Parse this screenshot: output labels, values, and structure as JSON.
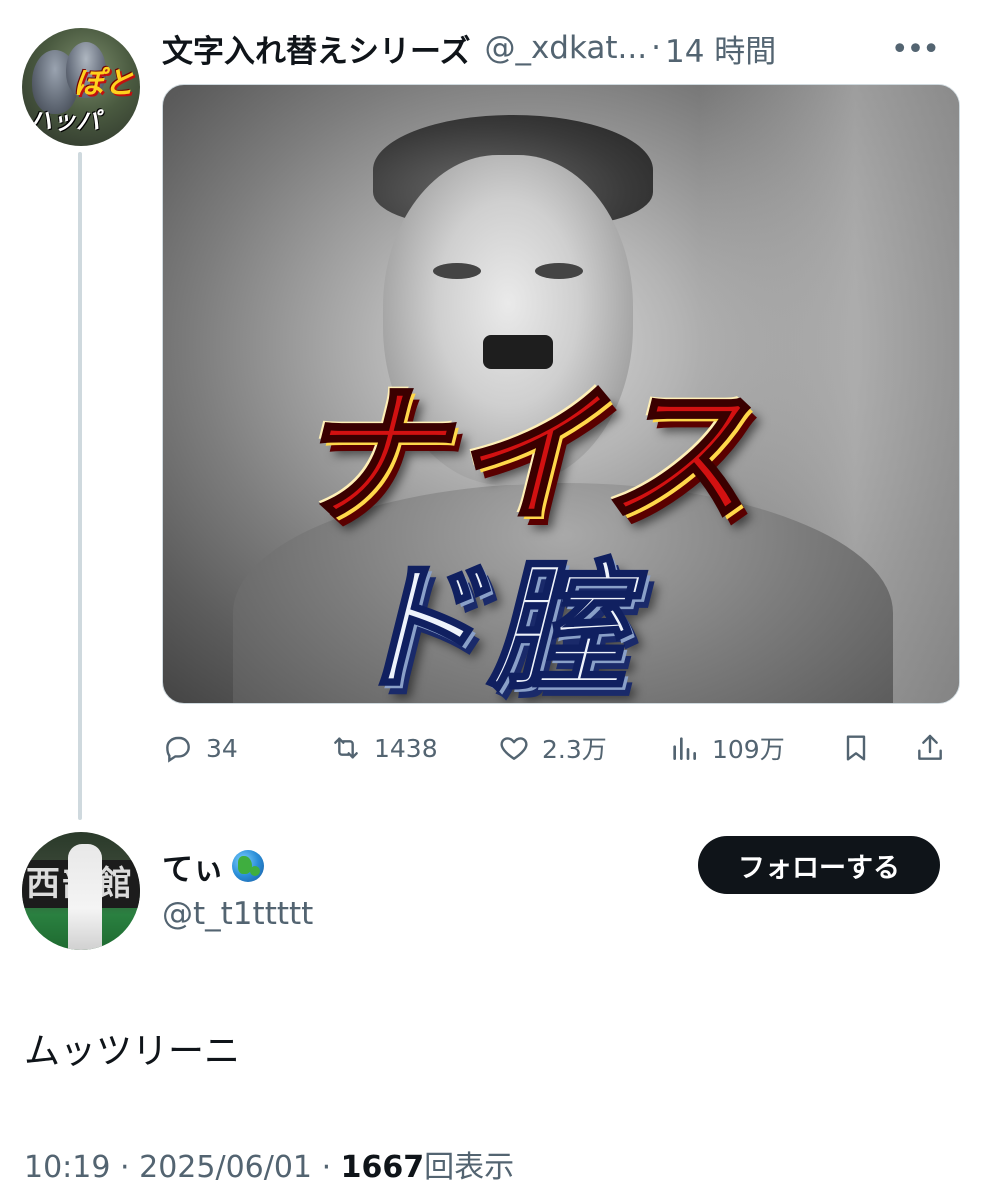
{
  "parent_tweet": {
    "display_name": "文字入れ替えシリーズ",
    "handle": "@_xdkat...",
    "separator": "·",
    "time": "14 時間",
    "more_icon": "more-horizontal-icon",
    "avatar": {
      "text_top": "ぽと",
      "text_bottom": "ハッパ"
    },
    "media": {
      "overlay_line_1": "ナイス",
      "overlay_line_2": "ド腟"
    },
    "actions": {
      "reply_count": "34",
      "retweet_count": "1438",
      "like_count": "2.3万",
      "view_count": "109万"
    }
  },
  "reply_tweet": {
    "display_name": "てぃ",
    "name_emoji": "globe-icon",
    "handle": "@t_t1ttttt",
    "follow_label": "フォローする",
    "avatar": {
      "sign_text": "西部館"
    },
    "text": "ムッツリーニ",
    "meta": {
      "time": "10:19",
      "separator": "·",
      "date": "2025/06/01",
      "views_count": "1667",
      "views_label": "回表示"
    }
  },
  "colors": {
    "text_primary": "#0f1419",
    "text_secondary": "#536471",
    "thread_line": "#cfd9de",
    "button_bg": "#0f1419"
  }
}
